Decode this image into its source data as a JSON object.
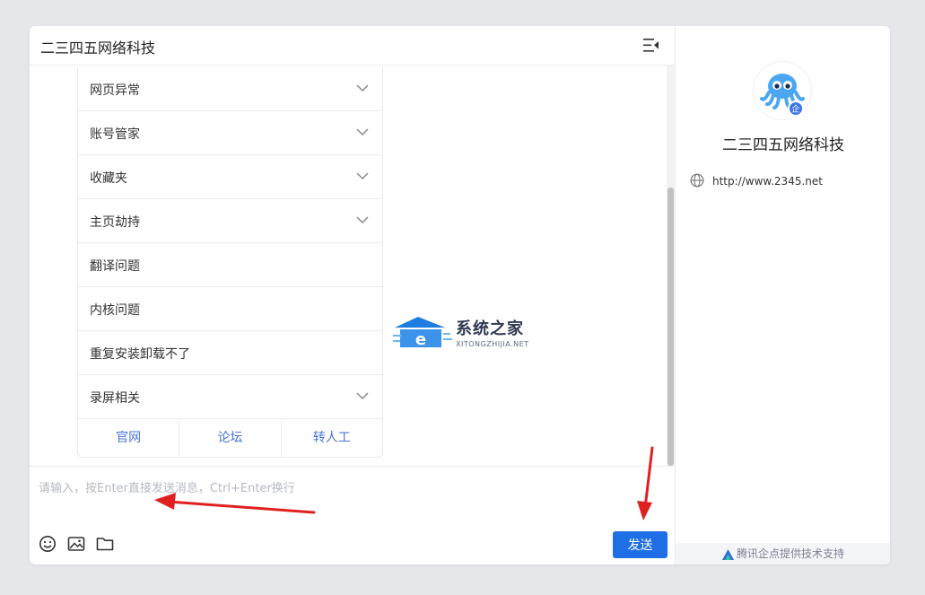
{
  "header": {
    "title": "二三四五网络科技"
  },
  "faq": {
    "items": [
      {
        "label": "网页异常",
        "expandable": true
      },
      {
        "label": "账号管家",
        "expandable": true
      },
      {
        "label": "收藏夹",
        "expandable": true
      },
      {
        "label": "主页劫持",
        "expandable": true
      },
      {
        "label": "翻译问题",
        "expandable": false
      },
      {
        "label": "内核问题",
        "expandable": false
      },
      {
        "label": "重复安装卸载不了",
        "expandable": false
      },
      {
        "label": "录屏相关",
        "expandable": true
      }
    ],
    "links": [
      "官网",
      "论坛",
      "转人工"
    ]
  },
  "watermark": {
    "title": "系统之家",
    "subtitle": "XITONGZHIJIA.NET"
  },
  "input": {
    "placeholder": "请输入，按Enter直接发送消息，Ctrl+Enter换行"
  },
  "toolbar": {
    "send_label": "发送",
    "icons": [
      "emoji-icon",
      "image-icon",
      "folder-icon"
    ]
  },
  "info": {
    "company_name": "二三四五网络科技",
    "badge": "企",
    "website": "http://www.2345.net"
  },
  "footer": {
    "text": "腾讯企点提供技术支持"
  },
  "colors": {
    "accent": "#1e6fe6",
    "link": "#4a73d9",
    "annotation": "#e02020"
  }
}
